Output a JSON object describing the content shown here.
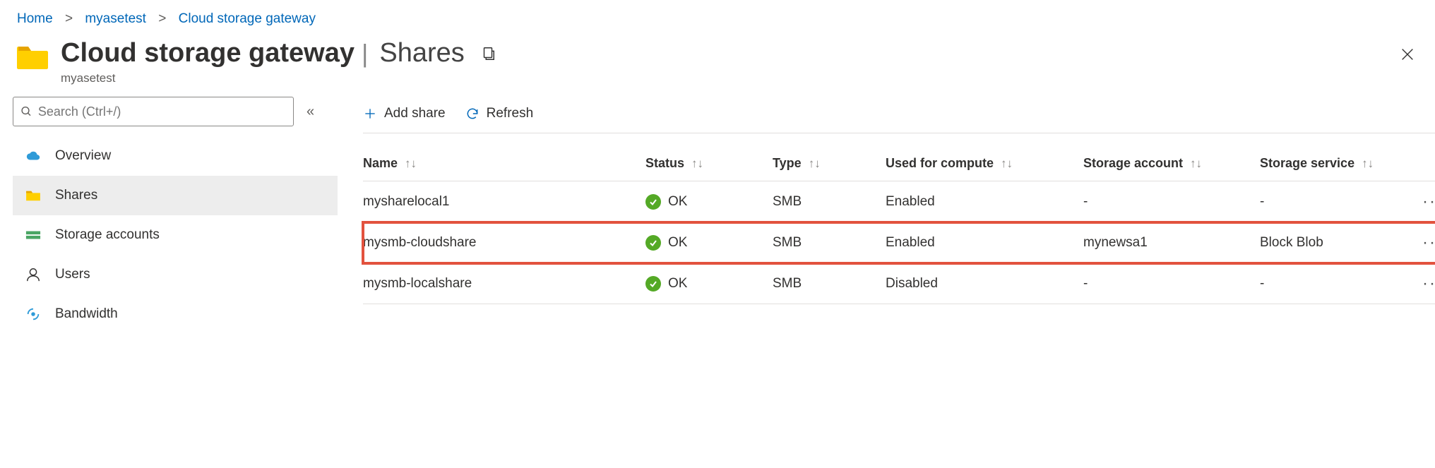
{
  "breadcrumb": [
    {
      "label": "Home"
    },
    {
      "label": "myasetest"
    },
    {
      "label": "Cloud storage gateway"
    }
  ],
  "header": {
    "title": "Cloud storage gateway",
    "section": "Shares",
    "subtitle": "myasetest"
  },
  "search": {
    "placeholder": "Search (Ctrl+/)"
  },
  "sidebar": {
    "items": [
      {
        "label": "Overview",
        "icon": "cloud-icon",
        "selected": false
      },
      {
        "label": "Shares",
        "icon": "folder-icon",
        "selected": true
      },
      {
        "label": "Storage accounts",
        "icon": "storage-icon",
        "selected": false
      },
      {
        "label": "Users",
        "icon": "user-icon",
        "selected": false
      },
      {
        "label": "Bandwidth",
        "icon": "signal-icon",
        "selected": false
      }
    ]
  },
  "toolbar": {
    "add_share": "Add share",
    "refresh": "Refresh"
  },
  "table": {
    "columns": [
      {
        "label": "Name"
      },
      {
        "label": "Status"
      },
      {
        "label": "Type"
      },
      {
        "label": "Used for compute"
      },
      {
        "label": "Storage account"
      },
      {
        "label": "Storage service"
      }
    ],
    "rows": [
      {
        "name": "mysharelocal1",
        "status": "OK",
        "type": "SMB",
        "compute": "Enabled",
        "account": "-",
        "service": "-",
        "highlight": false
      },
      {
        "name": "mysmb-cloudshare",
        "status": "OK",
        "type": "SMB",
        "compute": "Enabled",
        "account": "mynewsa1",
        "service": "Block Blob",
        "highlight": true
      },
      {
        "name": "mysmb-localshare",
        "status": "OK",
        "type": "SMB",
        "compute": "Disabled",
        "account": "-",
        "service": "-",
        "highlight": false
      }
    ]
  }
}
